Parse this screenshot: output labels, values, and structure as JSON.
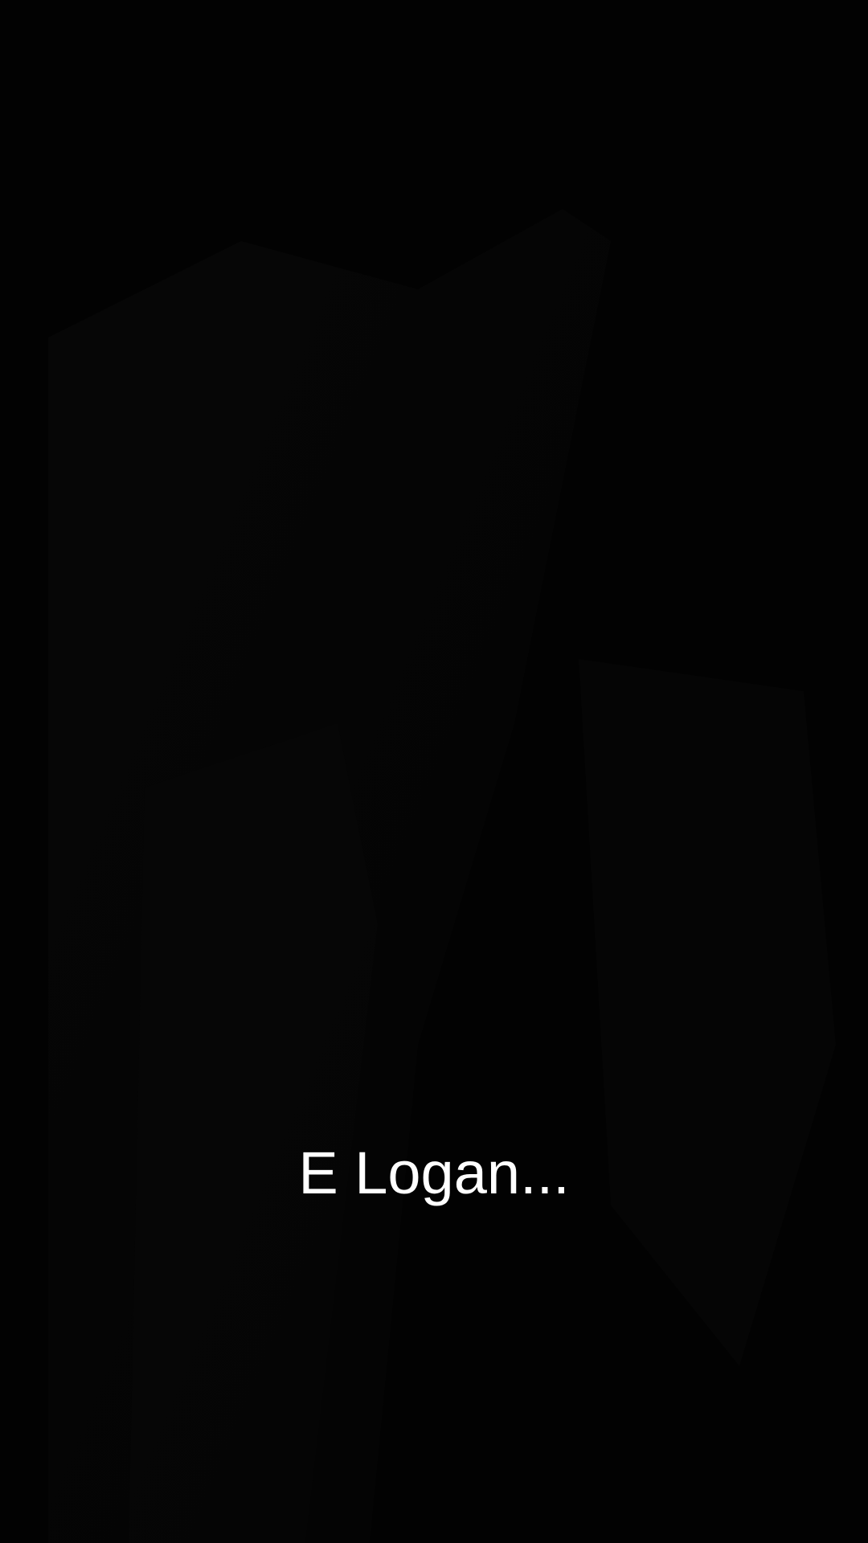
{
  "scene": {
    "caption": "E Logan...",
    "background_color": "#020202",
    "caption_color": "#ffffff"
  }
}
